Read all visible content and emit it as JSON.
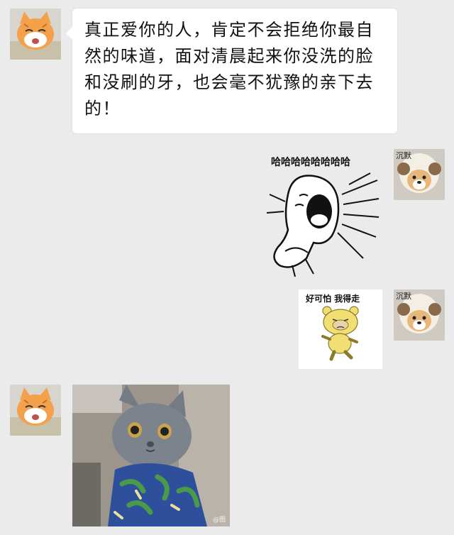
{
  "messages": [
    {
      "sender": "cat",
      "type": "text",
      "text": "真正爱你的人，肯定不会拒绝你最自然的味道，面对清晨起来你没洗的脸和没刷的牙，也会毫不犹豫的亲下去的！"
    },
    {
      "sender": "dog",
      "type": "sticker",
      "caption": "哈哈哈哈哈哈哈哈",
      "icon": "laughing-meme-sticker"
    },
    {
      "sender": "dog",
      "type": "sticker",
      "caption": "好可怕  我得走",
      "icon": "yellow-bear-sticker"
    },
    {
      "sender": "cat",
      "type": "image",
      "icon": "gray-cat-photo",
      "watermark": "@图"
    }
  ],
  "avatars": {
    "left_icon": "orange-cat-avatar",
    "right_icon": "dog-in-sheep-hat-avatar",
    "right_label": "沉默"
  },
  "colors": {
    "background": "#ebebeb",
    "bubble": "#ffffff",
    "text": "#111111"
  }
}
